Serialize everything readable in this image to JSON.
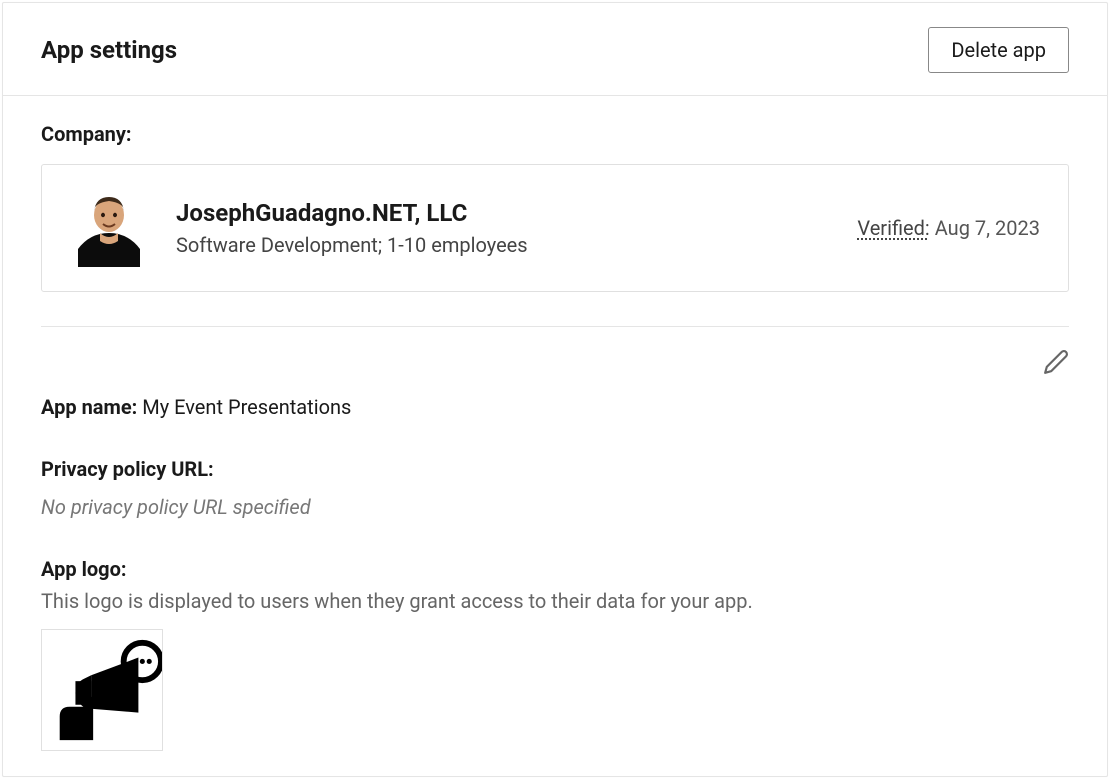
{
  "header": {
    "title": "App settings",
    "delete_button": "Delete app"
  },
  "company": {
    "label": "Company:",
    "name": "JosephGuadagno.NET, LLC",
    "description": "Software Development; 1-10 employees",
    "verified_label": "Verified:",
    "verified_date": "Aug 7, 2023"
  },
  "app_name": {
    "label": "App name:",
    "value": "My Event Presentations"
  },
  "privacy_policy": {
    "label": "Privacy policy URL:",
    "empty_text": "No privacy policy URL specified"
  },
  "app_logo": {
    "label": "App logo:",
    "helper": "This logo is displayed to users when they grant access to their data for your app."
  }
}
